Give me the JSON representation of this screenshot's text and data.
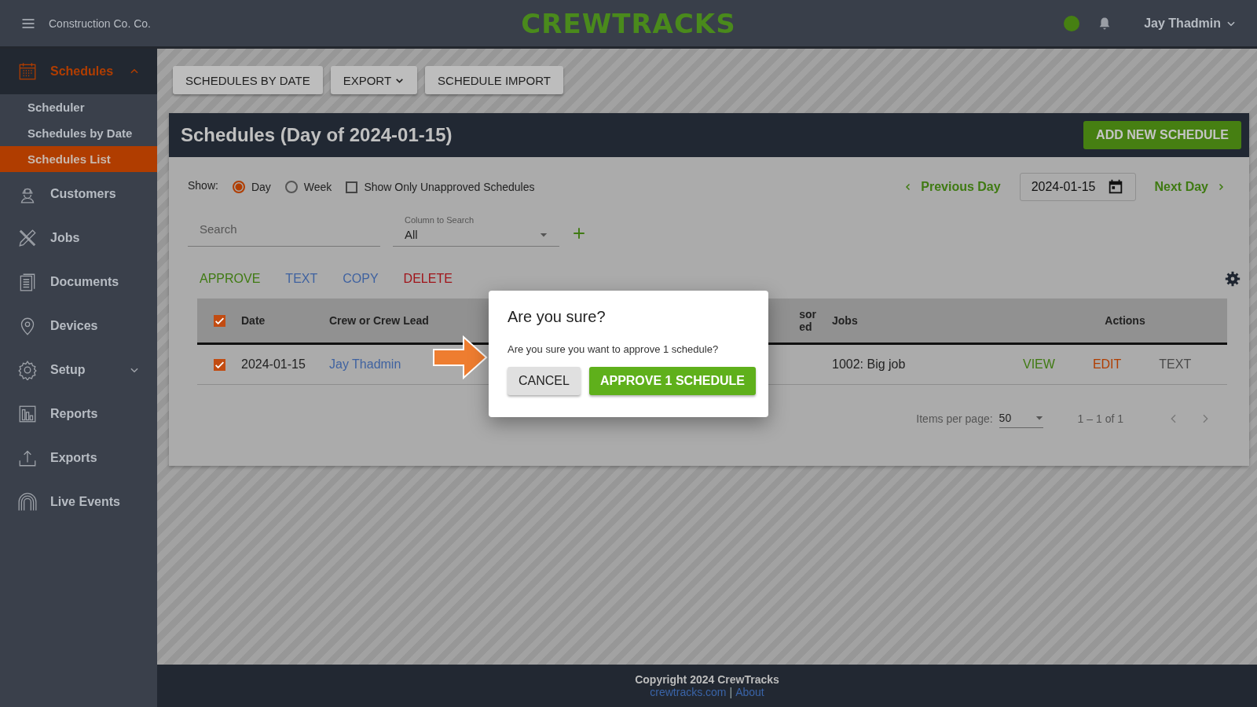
{
  "header": {
    "company": "Construction Co. Co.",
    "logo": "CREWTRACKS",
    "user": "Jay Thadmin"
  },
  "sidebar": {
    "items": [
      {
        "label": "Schedules",
        "selected": true,
        "expanded": true,
        "children": [
          {
            "label": "Scheduler",
            "selected": false
          },
          {
            "label": "Schedules by Date",
            "selected": false
          },
          {
            "label": "Schedules List",
            "selected": true
          }
        ]
      },
      {
        "label": "Customers",
        "selected": false
      },
      {
        "label": "Jobs",
        "selected": false
      },
      {
        "label": "Documents",
        "selected": false
      },
      {
        "label": "Devices",
        "selected": false
      },
      {
        "label": "Setup",
        "selected": false,
        "expanded": false
      },
      {
        "label": "Reports",
        "selected": false
      },
      {
        "label": "Exports",
        "selected": false
      },
      {
        "label": "Live Events",
        "selected": false
      }
    ]
  },
  "toolbar": [
    {
      "label": "SCHEDULES BY DATE",
      "kind": "plain"
    },
    {
      "label": "EXPORT",
      "kind": "menu"
    },
    {
      "label": "SCHEDULE IMPORT",
      "kind": "plain"
    }
  ],
  "card": {
    "title": "Schedules (Day of 2024-01-15)",
    "add_button": "ADD NEW SCHEDULE",
    "show_label": "Show:",
    "view_options": [
      {
        "label": "Day",
        "selected": true
      },
      {
        "label": "Week",
        "selected": false
      }
    ],
    "unapproved_only": {
      "label": "Show Only Unapproved Schedules",
      "checked": false
    },
    "previous": "Previous Day",
    "date": "2024-01-15",
    "next": "Next Day",
    "search": {
      "placeholder": "Search"
    },
    "column_select": {
      "label": "Column to Search",
      "value": "All"
    },
    "bulk_actions": [
      {
        "label": "APPROVE",
        "color": "#3f7a12"
      },
      {
        "label": "TEXT",
        "color": "#3f62a0"
      },
      {
        "label": "COPY",
        "color": "#3f62a0"
      },
      {
        "label": "DELETE",
        "color": "#a0141a"
      }
    ],
    "table": {
      "all_checked": true,
      "columns": [
        "Date",
        "Crew or Crew Lead",
        "sor\ned",
        "Jobs",
        "Actions"
      ],
      "rows": [
        {
          "checked": true,
          "date": "2024-01-15",
          "crew": "Jay Thadmin",
          "jobs": "1002: Big job",
          "actions": [
            {
              "label": "VIEW",
              "color": "#3f7a12"
            },
            {
              "label": "EDIT",
              "color": "#b03d00"
            },
            {
              "label": "TEXT",
              "color": "#4a4a4a"
            }
          ]
        }
      ]
    },
    "pagination": {
      "label": "Items per page:",
      "page_size": "50",
      "range": "1 – 1 of 1"
    }
  },
  "dialog": {
    "title": "Are you sure?",
    "message": "Are you sure you want to approve 1 schedule?",
    "cancel": "CANCEL",
    "confirm": "APPROVE 1 SCHEDULE"
  },
  "footer": {
    "copyright": "Copyright 2024 CrewTracks",
    "links": [
      "crewtracks.com",
      "About"
    ],
    "separator": "|"
  }
}
